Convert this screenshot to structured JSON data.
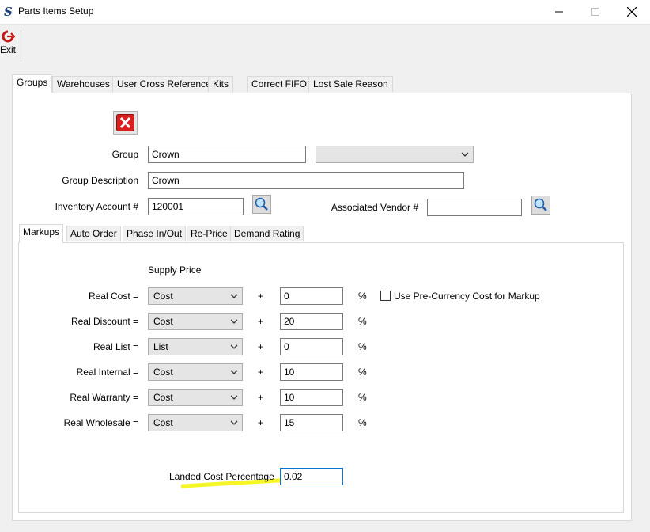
{
  "window": {
    "title": "Parts Items Setup",
    "app_icon": "S"
  },
  "toolbar": {
    "exit_label": "Exit"
  },
  "outer_tabs": [
    {
      "label": "Groups",
      "active": true
    },
    {
      "label": "Warehouses",
      "active": false
    },
    {
      "label": "User Cross Reference",
      "active": false
    },
    {
      "label": "Kits",
      "active": false
    },
    {
      "label": "Correct FIFO",
      "active": false
    },
    {
      "label": "Lost Sale Reason",
      "active": false
    }
  ],
  "form": {
    "group_label": "Group",
    "group_value": "Crown",
    "group_dropdown_value": "",
    "description_label": "Group Description",
    "description_value": "Crown",
    "inventory_label": "Inventory Account #",
    "inventory_value": "120001",
    "vendor_label": "Associated Vendor #",
    "vendor_value": ""
  },
  "inner_tabs": [
    {
      "label": "Markups",
      "active": true
    },
    {
      "label": "Auto Order",
      "active": false
    },
    {
      "label": "Phase In/Out",
      "active": false
    },
    {
      "label": "Re-Price",
      "active": false
    },
    {
      "label": "Demand Rating",
      "active": false
    }
  ],
  "markups": {
    "header": "Supply Price",
    "plus": "+",
    "percent": "%",
    "rows": [
      {
        "label": "Real Cost =",
        "basis": "Cost",
        "value": "0"
      },
      {
        "label": "Real Discount =",
        "basis": "Cost",
        "value": "20"
      },
      {
        "label": "Real List =",
        "basis": "List",
        "value": "0"
      },
      {
        "label": "Real Internal =",
        "basis": "Cost",
        "value": "10"
      },
      {
        "label": "Real Warranty =",
        "basis": "Cost",
        "value": "10"
      },
      {
        "label": "Real Wholesale =",
        "basis": "Cost",
        "value": "15"
      }
    ],
    "pre_currency_label": "Use Pre-Currency Cost for Markup",
    "pre_currency_checked": false,
    "landed_label": "Landed Cost Percentage",
    "landed_value": "0.02"
  },
  "colors": {
    "highlight": "#f5f500",
    "focus_border": "#0078d7",
    "delete_red": "#d92020"
  }
}
